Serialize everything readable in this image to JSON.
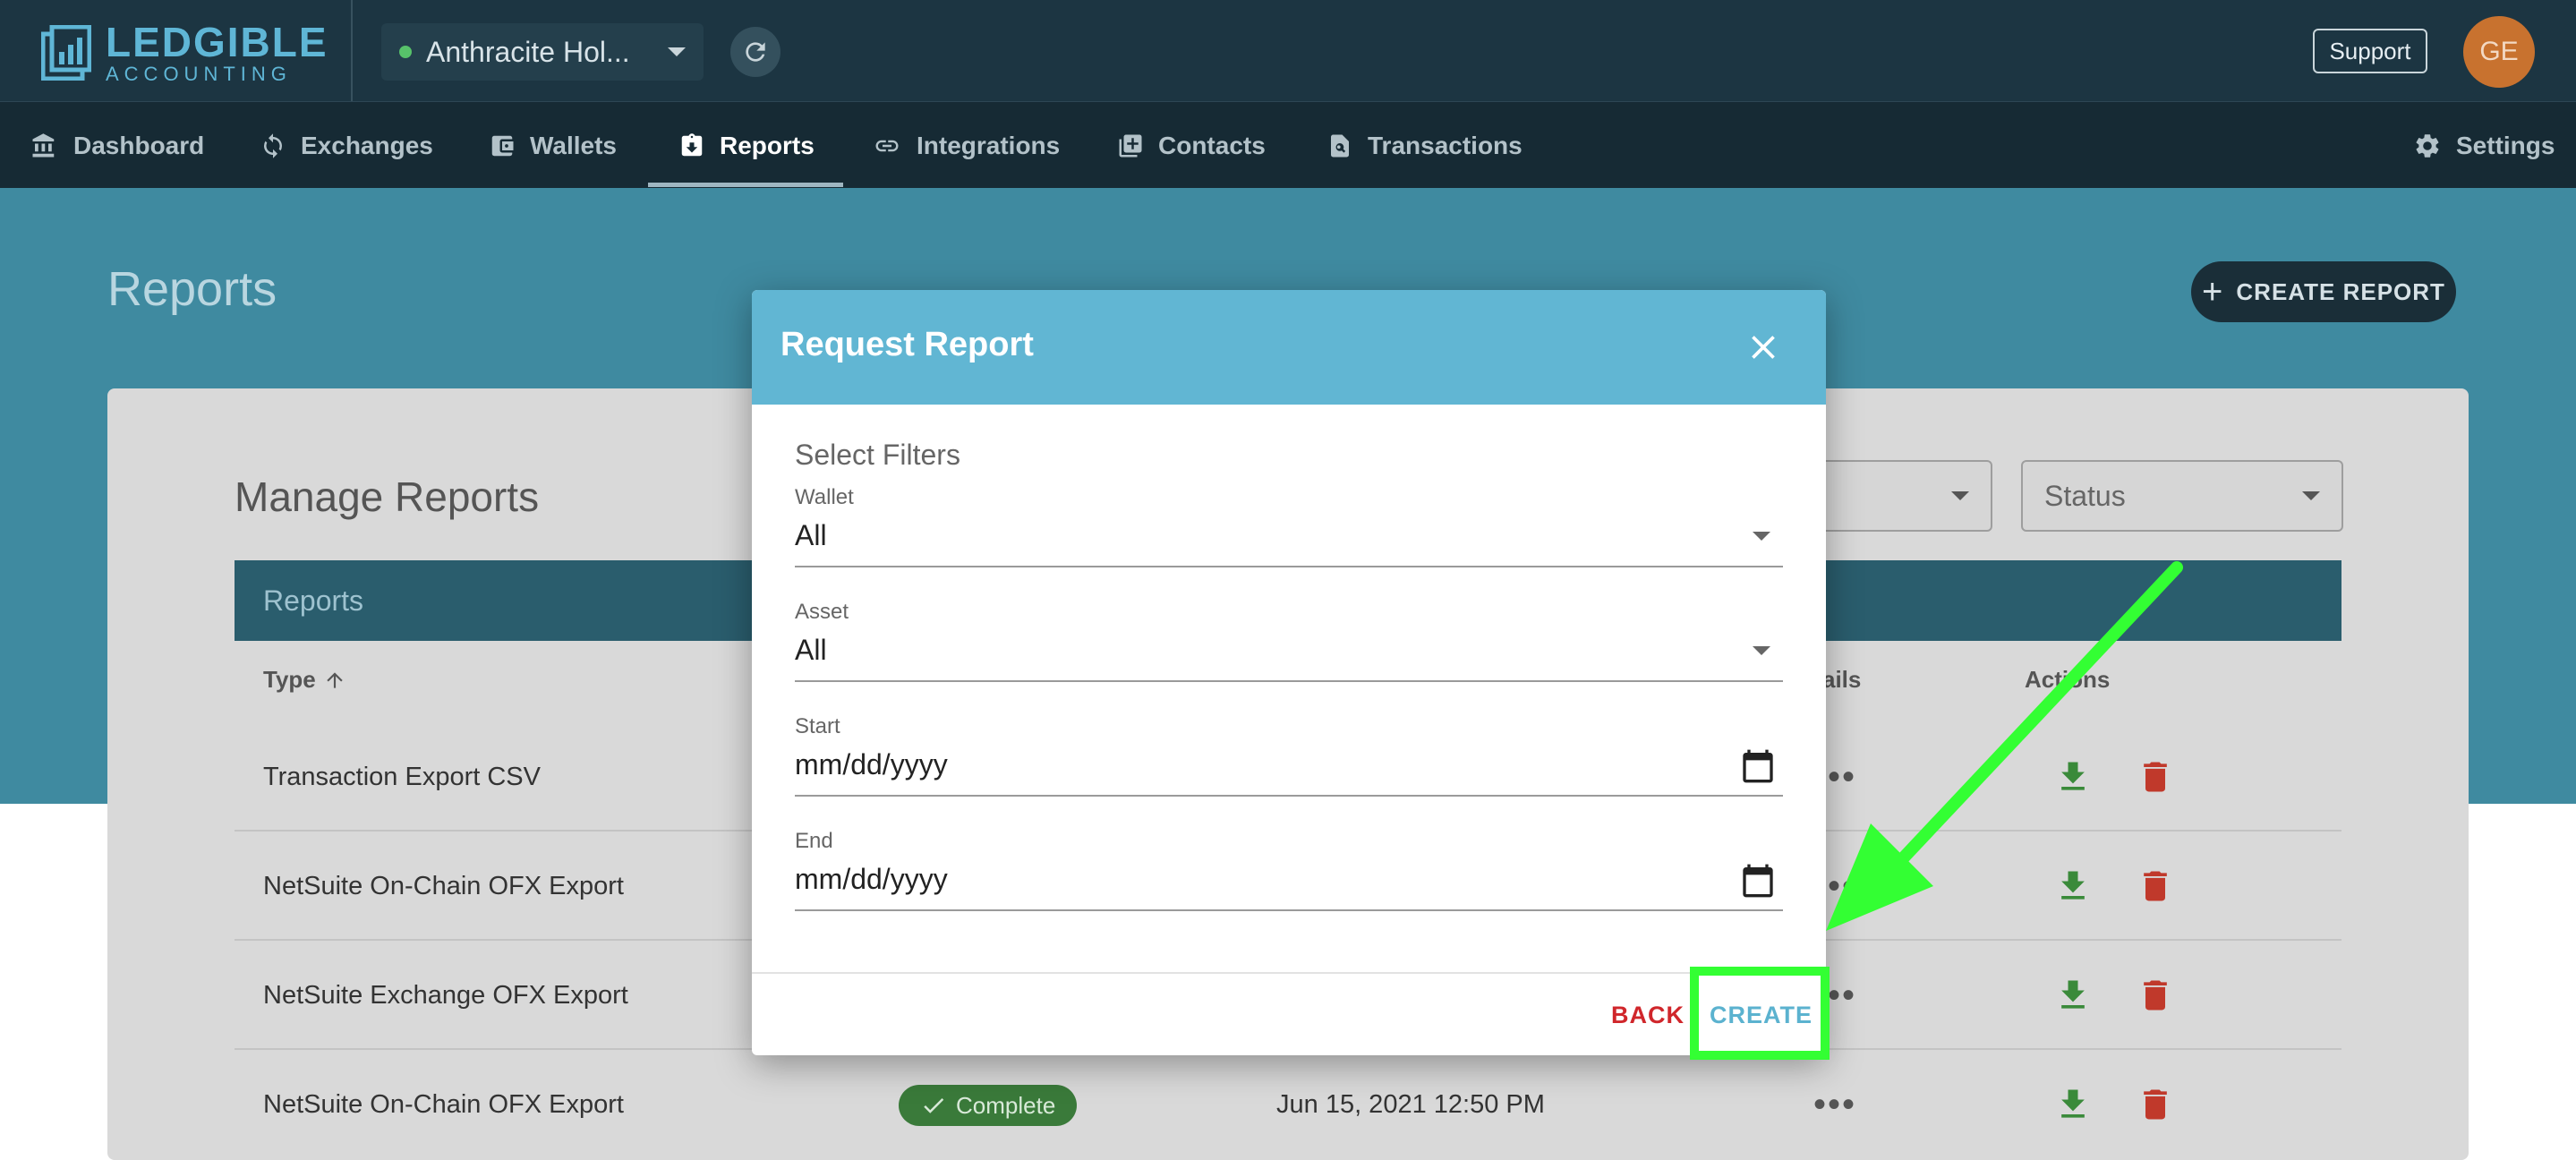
{
  "app": {
    "logo_name": "LEDGIBLE",
    "logo_sub": "ACCOUNTING",
    "workspace_name": "Anthracite Hol...",
    "support_label": "Support",
    "avatar_initials": "GE"
  },
  "nav": {
    "items": [
      {
        "label": "Dashboard",
        "icon": "bank-icon"
      },
      {
        "label": "Exchanges",
        "icon": "sync-icon"
      },
      {
        "label": "Wallets",
        "icon": "wallet-icon"
      },
      {
        "label": "Reports",
        "icon": "clipboard-icon"
      },
      {
        "label": "Integrations",
        "icon": "link-icon"
      },
      {
        "label": "Contacts",
        "icon": "contacts-icon"
      },
      {
        "label": "Transactions",
        "icon": "search-document-icon"
      }
    ],
    "settings_label": "Settings",
    "active": "Reports"
  },
  "page": {
    "title": "Reports",
    "create_report_label": "CREATE REPORT",
    "manage_title": "Manage Reports",
    "status_filter_label": "Status",
    "table_title": "Reports",
    "columns": {
      "type": "Type",
      "details": "ails",
      "actions": "Actions"
    },
    "rows": [
      {
        "type": "Transaction Export CSV"
      },
      {
        "type": "NetSuite On-Chain OFX Export"
      },
      {
        "type": "NetSuite Exchange OFX Export"
      },
      {
        "type": "NetSuite On-Chain OFX Export",
        "status": "Complete",
        "date": "Jun 15, 2021 12:50 PM"
      }
    ]
  },
  "modal": {
    "title": "Request Report",
    "section_label": "Select Filters",
    "fields": {
      "wallet": {
        "label": "Wallet",
        "value": "All"
      },
      "asset": {
        "label": "Asset",
        "value": "All"
      },
      "start": {
        "label": "Start",
        "value": "mm/dd/yyyy"
      },
      "end": {
        "label": "End",
        "value": "mm/dd/yyyy"
      }
    },
    "back_label": "BACK",
    "create_label": "CREATE"
  },
  "colors": {
    "topbar": "#1c3542",
    "modal_header": "#61b6d3",
    "back": "#d0262b",
    "create": "#5bb2cf",
    "highlight": "#33ff33"
  }
}
